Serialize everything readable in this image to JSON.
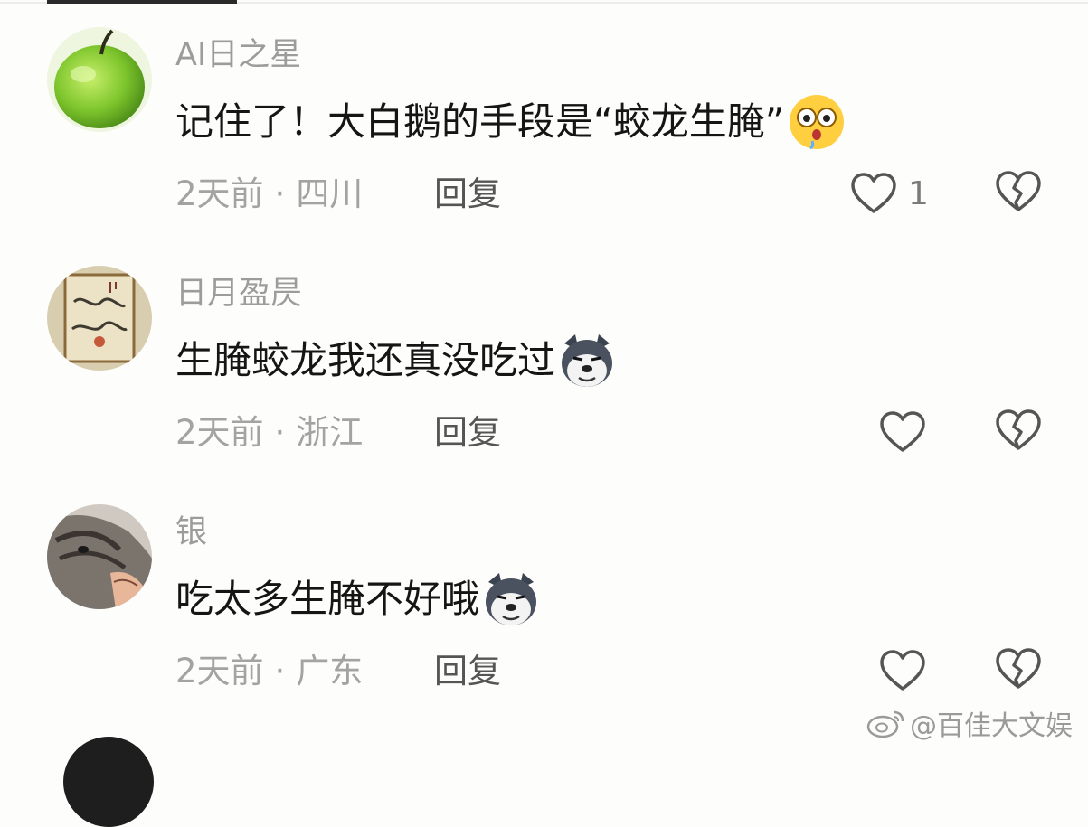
{
  "comments": [
    {
      "username": "AI日之星",
      "text": "记住了！大白鹅的手段是“蛟龙生腌”",
      "emoji": "flushed-face-emoji",
      "time": "2天前",
      "separator": "·",
      "location": "四川",
      "reply_label": "回复",
      "like_count": "1",
      "avatar": "green-apple-avatar"
    },
    {
      "username": "日月盈昃",
      "text": "生腌蛟龙我还真没吃过",
      "emoji": "husky-dog-emoji",
      "time": "2天前",
      "separator": "·",
      "location": "浙江",
      "reply_label": "回复",
      "like_count": "",
      "avatar": "dragon-painting-avatar"
    },
    {
      "username": "银",
      "text": "吃太多生腌不好哦",
      "emoji": "husky-dog-emoji",
      "time": "2天前",
      "separator": "·",
      "location": "广东",
      "reply_label": "回复",
      "like_count": "",
      "avatar": "cat-photo-avatar"
    }
  ],
  "icons": {
    "like": "heart-outline-icon",
    "dislike": "broken-heart-icon"
  },
  "watermark": {
    "icon": "weibo-logo-icon",
    "text": "@百佳大文娱"
  },
  "colors": {
    "background": "#fdfdfb",
    "username": "#9c9c9c",
    "content": "#151515",
    "meta": "#a3a3a3"
  }
}
